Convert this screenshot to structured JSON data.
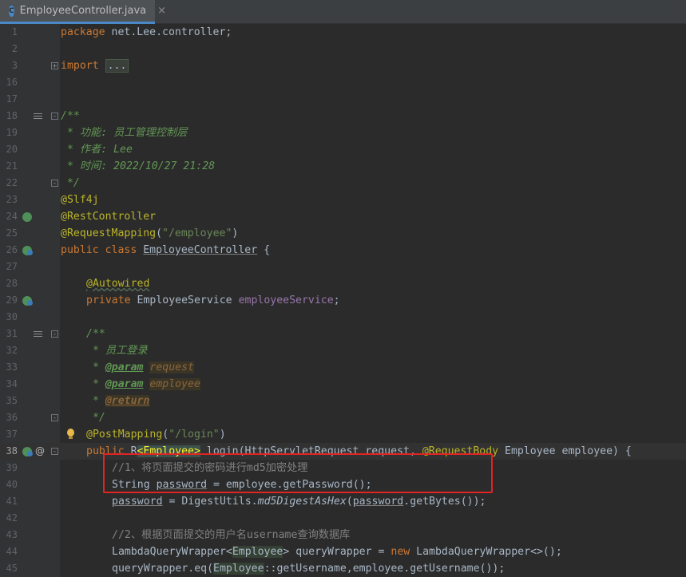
{
  "tab": {
    "icon_letter": "C",
    "filename": "EmployeeController.java",
    "close": "×"
  },
  "lines": [
    {
      "n": "1",
      "t": "package net.Lee.controller;"
    },
    {
      "n": "2",
      "t": ""
    },
    {
      "n": "3",
      "t": "import ..."
    },
    {
      "n": "16",
      "t": ""
    },
    {
      "n": "17",
      "t": ""
    },
    {
      "n": "18",
      "t": "/**"
    },
    {
      "n": "19",
      "t": " * 功能: 员工管理控制层"
    },
    {
      "n": "20",
      "t": " * 作者: Lee"
    },
    {
      "n": "21",
      "t": " * 时间: 2022/10/27 21:28"
    },
    {
      "n": "22",
      "t": " */"
    },
    {
      "n": "23",
      "t": "@Slf4j"
    },
    {
      "n": "24",
      "t": "@RestController"
    },
    {
      "n": "25",
      "t": "@RequestMapping(\"/employee\")"
    },
    {
      "n": "26",
      "t": "public class EmployeeController {"
    },
    {
      "n": "27",
      "t": ""
    },
    {
      "n": "28",
      "t": "@Autowired"
    },
    {
      "n": "29",
      "t": "private EmployeeService employeeService;"
    },
    {
      "n": "30",
      "t": ""
    },
    {
      "n": "31",
      "t": "/**"
    },
    {
      "n": "32",
      "t": " * 员工登录"
    },
    {
      "n": "33",
      "t": " * @param request"
    },
    {
      "n": "34",
      "t": " * @param employee"
    },
    {
      "n": "35",
      "t": " * @return"
    },
    {
      "n": "36",
      "t": " */"
    },
    {
      "n": "37",
      "t": "@PostMapping(\"/login\")"
    },
    {
      "n": "38",
      "t": "public R<Employee> login(HttpServletRequest request, @RequestBody Employee employee) {"
    },
    {
      "n": "39",
      "t": "//1、将页面提交的密码进行md5加密处理"
    },
    {
      "n": "40",
      "t": "String password = employee.getPassword();"
    },
    {
      "n": "41",
      "t": "password = DigestUtils.md5DigestAsHex(password.getBytes());"
    },
    {
      "n": "42",
      "t": ""
    },
    {
      "n": "43",
      "t": "//2、根据页面提交的用户名username查询数据库"
    },
    {
      "n": "44",
      "t": "LambdaQueryWrapper<Employee> queryWrapper = new LambdaQueryWrapper<>();"
    },
    {
      "n": "45",
      "t": "queryWrapper.eq(Employee::getUsername,employee.getUsername());"
    }
  ]
}
